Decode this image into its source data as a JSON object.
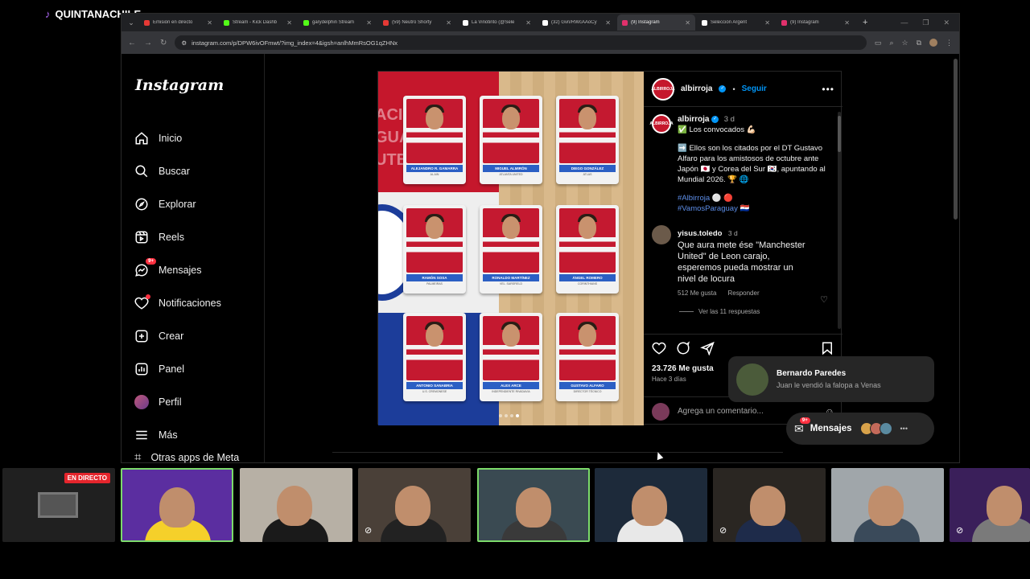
{
  "stream": {
    "channel": "QUINTANACHILE",
    "live_label": "EN DIRECTO"
  },
  "browser": {
    "tabs": [
      {
        "title": "Emisión en directo",
        "color": "#e53935"
      },
      {
        "title": "Stream - Kick Dashb",
        "color": "#53fc18"
      },
      {
        "title": "garydelphin Stream",
        "color": "#53fc18"
      },
      {
        "title": "(59) Neutro Shorty",
        "color": "#e53935"
      },
      {
        "title": "La Vinotinto (@Sele",
        "color": "#ffffff"
      },
      {
        "title": "(32) Gvn/RWcAAoCy",
        "color": "#ffffff"
      },
      {
        "title": "(9) Instagram",
        "color": "#e1306c",
        "active": true
      },
      {
        "title": "Selección Argent",
        "color": "#ffffff"
      },
      {
        "title": "(9) Instagram",
        "color": "#e1306c"
      }
    ],
    "url": "instagram.com/p/DPW6ivOFmwt/?img_index=4&igsh=anlhMmRsOG1qZHNx"
  },
  "sidebar": {
    "logo": "Instagram",
    "items": [
      {
        "label": "Inicio",
        "icon": "home-icon"
      },
      {
        "label": "Buscar",
        "icon": "search-icon"
      },
      {
        "label": "Explorar",
        "icon": "compass-icon"
      },
      {
        "label": "Reels",
        "icon": "reels-icon"
      },
      {
        "label": "Mensajes",
        "icon": "messenger-icon",
        "badge": "9+"
      },
      {
        "label": "Notificaciones",
        "icon": "heart-icon",
        "dot": true
      },
      {
        "label": "Crear",
        "icon": "plus-square-icon"
      },
      {
        "label": "Panel",
        "icon": "chart-icon"
      },
      {
        "label": "Perfil",
        "icon": "avatar"
      },
      {
        "label": "Más",
        "icon": "menu-icon"
      }
    ],
    "other_apps": "Otras apps de Meta"
  },
  "post": {
    "image": {
      "bg_text": [
        "ACI",
        "GUA",
        "UTB"
      ],
      "players": [
        {
          "name": "ALEJANDRO R. GAMARRA",
          "club": "AL AIN"
        },
        {
          "name": "MIGUEL ALMIRÓN",
          "club": "ATLANTA UNITED"
        },
        {
          "name": "DIEGO GONZÁLEZ",
          "club": "ATLAS"
        },
        {
          "name": "RAMÓN SOSA",
          "club": "PALMEIRAS"
        },
        {
          "name": "RONALDO MARTÍNEZ",
          "club": "VEL. SARSFIELD"
        },
        {
          "name": "ÁNGEL ROMERO",
          "club": "CORINTHIANS"
        },
        {
          "name": "ANTONIO SANABRIA",
          "club": "U.S. CREMONESE"
        },
        {
          "name": "ALEX ARCE",
          "club": "INDEPENDIENTE RIVADAVIA"
        },
        {
          "name": "GUSTAVO ALFARO",
          "club": "DIRECTOR TÉCNICO"
        }
      ]
    },
    "header": {
      "username": "albirroja",
      "follow": "Seguir",
      "avatar_text": "ALBIRROJA"
    },
    "caption": {
      "username": "albirroja",
      "time": "3 d",
      "line1": "✅ Los convocados 💪🏻",
      "line2": "➡️ Ellos son los citados por el DT Gustavo Alfaro para los amistosos de octubre ante Japón 🇯🇵 y Corea del Sur 🇰🇷, apuntando al Mundial 2026. 🏆 🌐",
      "hashtag1": "#Albirroja ⚪ 🔴",
      "hashtag2": "#VamosParaguay 🇵🇾"
    },
    "comment": {
      "username": "yisus.toledo",
      "time": "3 d",
      "text": "Que aura mete ése \"Manchester United\" de Leon carajo, esperemos pueda mostrar un nivel de locura",
      "likes": "512 Me gusta",
      "reply": "Responder",
      "view_replies": "Ver las 11 respuestas"
    },
    "likes": "23.726 Me gusta",
    "posted_ago": "Hace 3 días",
    "comment_placeholder": "Agrega un comentario..."
  },
  "notification": {
    "name": "Bernardo Paredes",
    "message": "Juan le vendió la falopa a Venas"
  },
  "messages_pill": {
    "label": "Mensajes",
    "badge": "9+"
  },
  "cams": [
    {
      "bg": "#202020",
      "type": "screen"
    },
    {
      "bg": "#5b2ea0",
      "shirt": "#f5d02a",
      "highlight": true
    },
    {
      "bg": "#b7b0a5",
      "shirt": "#1a1a1a"
    },
    {
      "bg": "#4a4038",
      "shirt": "#222222",
      "muted": true
    },
    {
      "bg": "#3a4a52",
      "shirt": "#3a3a3a",
      "highlight": true
    },
    {
      "bg": "#1d2a3a",
      "shirt": "#e8e8e8"
    },
    {
      "bg": "#2a2622",
      "shirt": "#1e2b4a",
      "muted": true
    },
    {
      "bg": "#a0a6aa",
      "shirt": "#3a4a5a"
    },
    {
      "bg": "#3a1f5a",
      "shirt": "#7a7a7a",
      "muted": true
    }
  ]
}
